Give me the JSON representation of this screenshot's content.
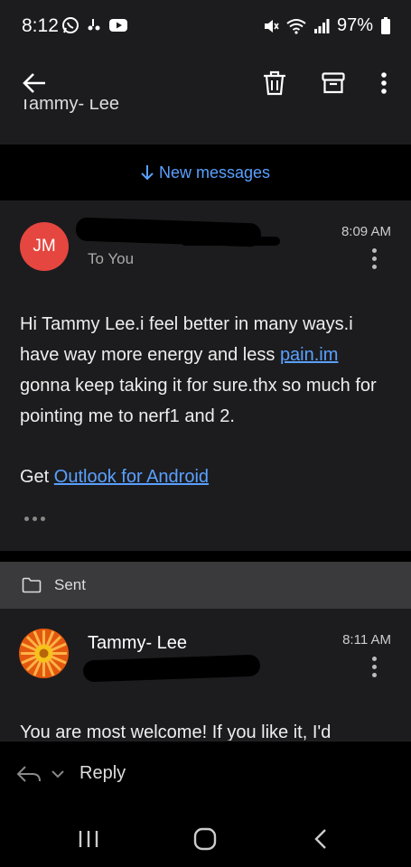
{
  "status_bar": {
    "time": "8:12",
    "battery": "97%",
    "left_icons": [
      "whatsapp-icon",
      "voicemail-icon",
      "youtube-icon"
    ],
    "right_icons": [
      "mute-icon",
      "wifi-icon",
      "signal-icon",
      "battery-icon"
    ]
  },
  "toolbar": {
    "icons": [
      "back-arrow-icon",
      "trash-icon",
      "archive-icon",
      "more-vert-icon"
    ]
  },
  "previous": {
    "sender_fragment": "Tammy- Lee"
  },
  "new_messages_banner": {
    "label": "New messages"
  },
  "message1": {
    "avatar_initials": "JM",
    "avatar_color": "#e5463f",
    "recipient": "To You",
    "time": "8:09 AM",
    "body_part1": "Hi Tammy Lee.i feel better in many ways.i have way more energy and less ",
    "body_link": "pain.im",
    "body_part2": " gonna keep taking it for sure.thx so much for pointing  me to nerf1 and 2.",
    "signature_prefix": "Get ",
    "signature_link": "Outlook for Android"
  },
  "folder_bar": {
    "label": "Sent"
  },
  "message2": {
    "sender": "Tammy- Lee",
    "time": "8:11 AM",
    "body_preview": "You are most welcome! If you like it, I'd"
  },
  "reply_bar": {
    "label": "Reply"
  },
  "nav": {
    "icons": [
      "recents-icon",
      "home-icon",
      "back-icon"
    ]
  },
  "colors": {
    "background": "#1c1c1e",
    "accent_link": "#5aa0ff",
    "folder_bar": "#3a3a3c"
  }
}
